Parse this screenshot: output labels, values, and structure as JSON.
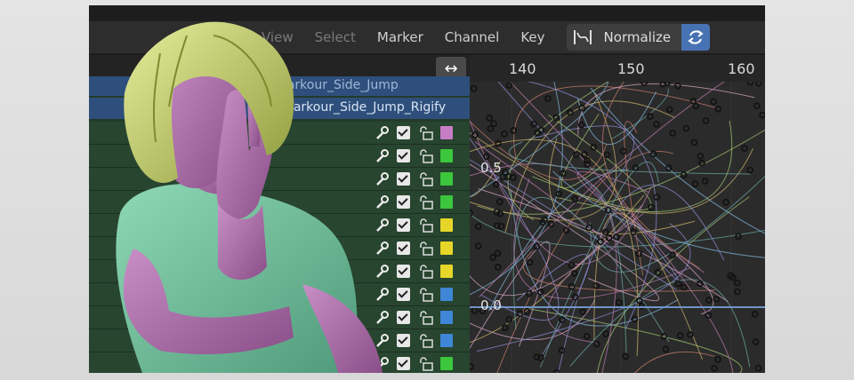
{
  "header": {
    "menu": [
      {
        "label": "View",
        "faded": true
      },
      {
        "label": "Select",
        "faded": true
      },
      {
        "label": "Marker",
        "faded": false
      },
      {
        "label": "Channel",
        "faded": false
      },
      {
        "label": "Key",
        "faded": false
      }
    ],
    "normalize_label": "Normalize",
    "accent": "#4772b3"
  },
  "timeline": {
    "ticks": [
      "140",
      "150",
      "160"
    ]
  },
  "graph": {
    "value_labels": [
      "0.5",
      "0.0"
    ]
  },
  "channels": {
    "action_top": "Parkour_Side_Jump",
    "action_name": "Parkour_Side_Jump_Rigify",
    "rows": [
      {
        "color": "#c77dc5"
      },
      {
        "color": "#3cc63c"
      },
      {
        "color": "#3cc63c"
      },
      {
        "color": "#3cc63c"
      },
      {
        "color": "#e6d629"
      },
      {
        "color": "#e6d629"
      },
      {
        "color": "#e6d629"
      },
      {
        "color": "#3f86d6"
      },
      {
        "color": "#3f86d6"
      },
      {
        "color": "#3f86d6"
      },
      {
        "color": "#3cc63c"
      }
    ]
  },
  "overlay": {
    "character": "woman-3d-figure"
  }
}
